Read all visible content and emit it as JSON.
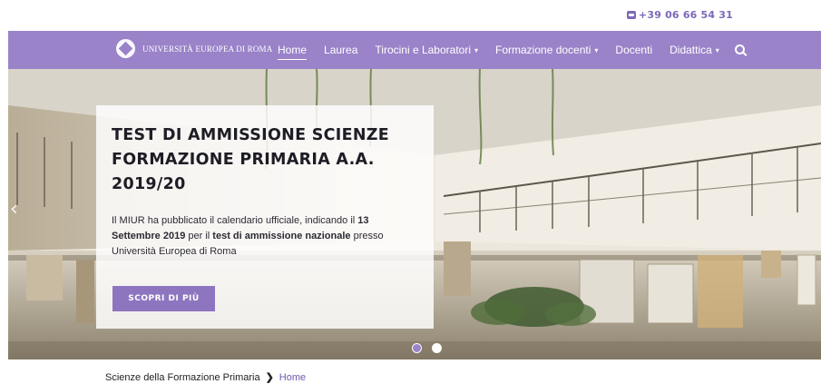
{
  "topbar": {
    "phone_icon": "phone-icon",
    "phone": "+39 06 66 54 31"
  },
  "header": {
    "logo_icon": "university-logo-icon",
    "brand": "UNIVERSITÀ EUROPEA DI ROMA",
    "nav": [
      {
        "label": "Home",
        "active": true,
        "dropdown": false
      },
      {
        "label": "Laurea",
        "active": false,
        "dropdown": false
      },
      {
        "label": "Tirocini e Laboratori",
        "active": false,
        "dropdown": true
      },
      {
        "label": "Formazione docenti",
        "active": false,
        "dropdown": true
      },
      {
        "label": "Docenti",
        "active": false,
        "dropdown": false
      },
      {
        "label": "Didattica",
        "active": false,
        "dropdown": true
      }
    ],
    "caret_glyph": "▾",
    "search_icon": "search-icon"
  },
  "hero": {
    "prev_glyph": "‹",
    "title": "TEST DI AMMISSIONE SCIENZE FORMAZIONE PRIMARIA A.A. 2019/20",
    "text_parts": [
      {
        "t": "Il MIUR ha pubblicato il calendario ufficiale, indicando il ",
        "b": false
      },
      {
        "t": "13 Settembre 2019",
        "b": true
      },
      {
        "t": " per il ",
        "b": false
      },
      {
        "t": "test di ammissione nazionale",
        "b": true
      },
      {
        "t": " presso Università Europea di Roma",
        "b": false
      }
    ],
    "button": "SCOPRI DI PIÙ",
    "slides_total": 2,
    "active_slide": 1
  },
  "breadcrumb": {
    "parent": "Scienze della Formazione Primaria",
    "separator": "❯",
    "current": "Home"
  },
  "colors": {
    "brand_purple": "#9a83c9",
    "button_purple": "#8d76bf",
    "link_purple": "#6f58b0"
  }
}
